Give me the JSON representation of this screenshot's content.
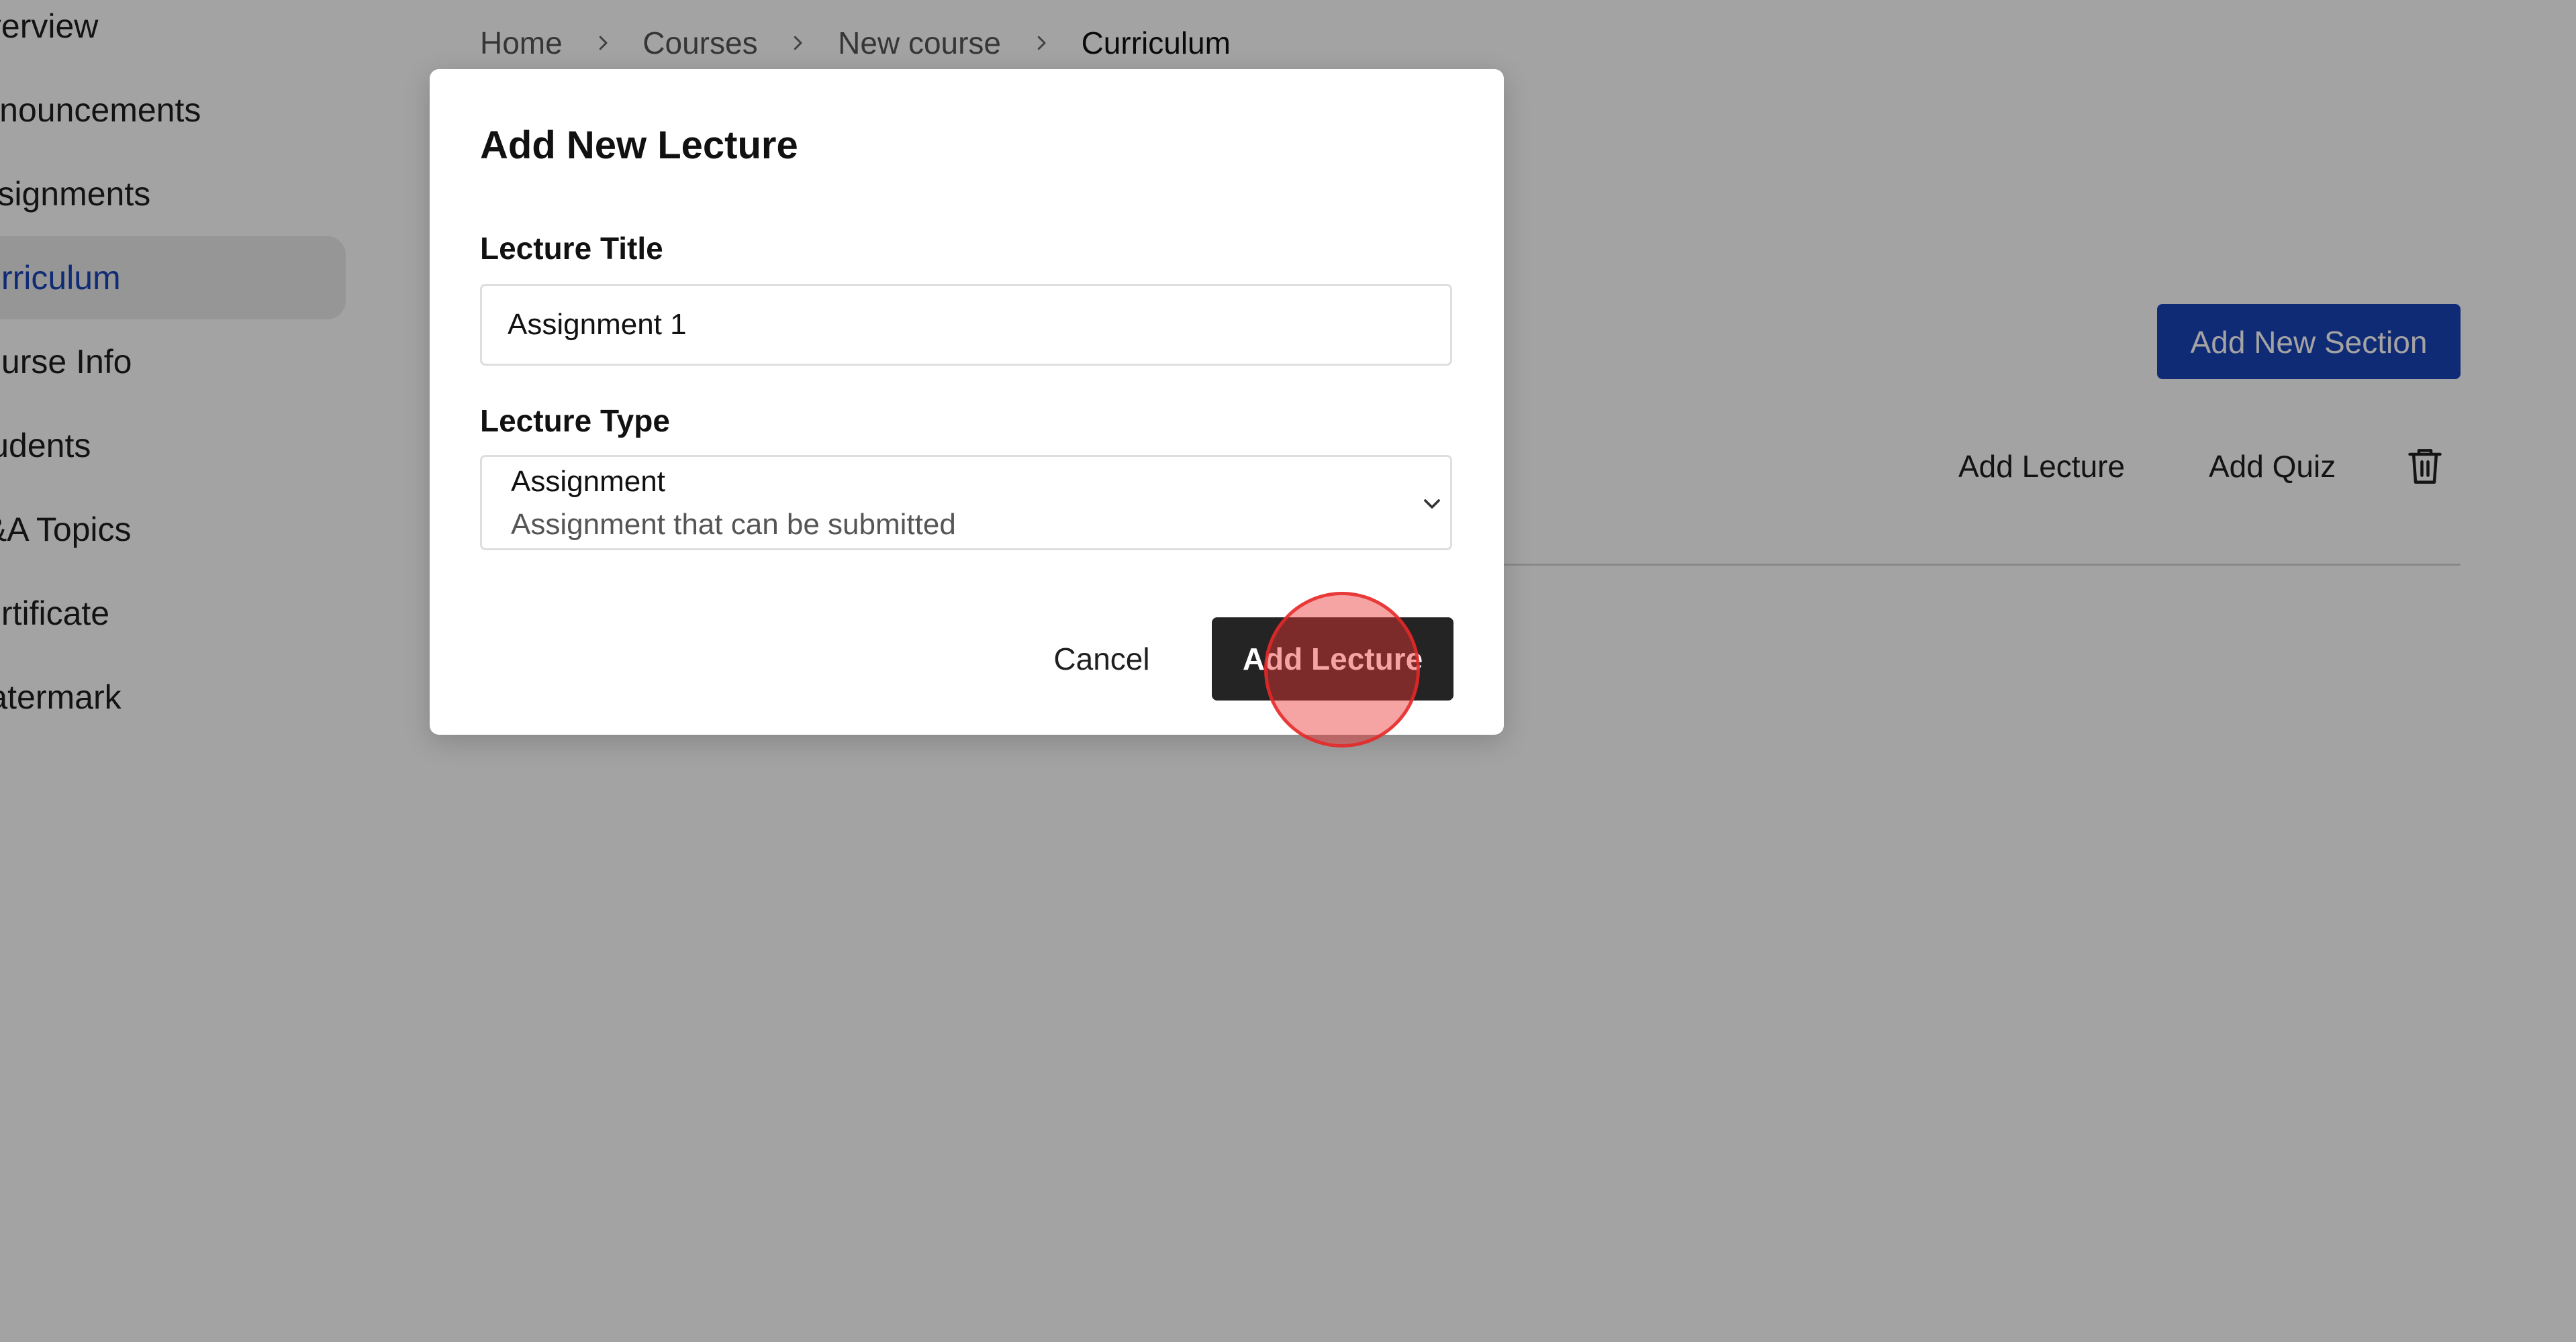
{
  "sidebar": {
    "items": [
      {
        "label": "Overview"
      },
      {
        "label": "Announcements"
      },
      {
        "label": "Assignments"
      },
      {
        "label": "Curriculum",
        "active": true
      },
      {
        "label": "Course Info"
      },
      {
        "label": "Students"
      },
      {
        "label": "Q&A Topics"
      },
      {
        "label": "Certificate"
      },
      {
        "label": "Watermark"
      }
    ]
  },
  "breadcrumb": [
    "Home",
    "Courses",
    "New course",
    "Curriculum"
  ],
  "section": {
    "add_section_label": "Add New Section",
    "add_lecture_label": "Add Lecture",
    "add_quiz_label": "Add Quiz",
    "delete_icon": "trash-icon"
  },
  "modal": {
    "title": "Add New Lecture",
    "title_field": {
      "label": "Lecture Title",
      "value": "Assignment 1"
    },
    "type_field": {
      "label": "Lecture Type",
      "selected": "Assignment",
      "description": "Assignment that can be submitted"
    },
    "cancel_label": "Cancel",
    "submit_label": "Add Lecture"
  },
  "colors": {
    "accent": "#1a44b8",
    "primary_button": "#242424",
    "overlay": "rgba(0,0,0,0.36)",
    "click_indicator": "#e62828"
  }
}
